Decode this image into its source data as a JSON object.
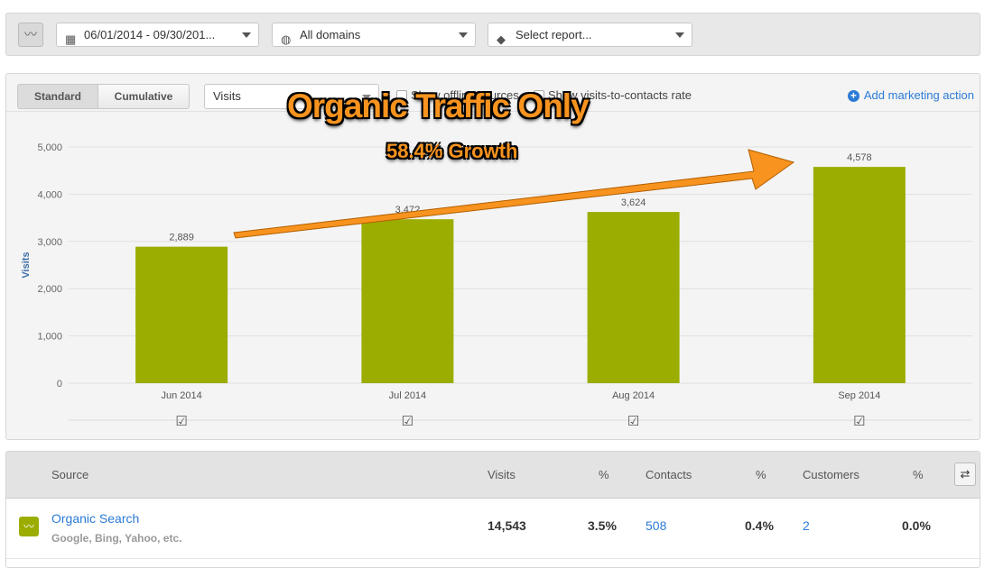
{
  "toolbar": {
    "date_range": "06/01/2014 - 09/30/201...",
    "domains": "All domains",
    "report": "Select report..."
  },
  "controls": {
    "standard": "Standard",
    "cumulative": "Cumulative",
    "metric": "Visits",
    "show_offline": "Show offline sources",
    "show_rate": "Show visits-to-contacts rate",
    "add_action": "Add marketing action"
  },
  "annotation": {
    "title": "Organic Traffic Only",
    "subtitle": "58.4% Growth"
  },
  "chart_data": {
    "type": "bar",
    "categories": [
      "Jun 2014",
      "Jul 2014",
      "Aug 2014",
      "Sep 2014"
    ],
    "values": [
      2889,
      3470,
      3624,
      4578
    ],
    "labels": [
      "2,889",
      "3,47?",
      "3,624",
      "4,578"
    ],
    "ylabel": "Visits",
    "ylim": [
      0,
      5000
    ],
    "yticks": [
      "0",
      "1,000",
      "2,000",
      "3,000",
      "4,000",
      "5,000"
    ],
    "grid": true,
    "color": "#9aad00"
  },
  "table": {
    "headers": [
      "Source",
      "Visits",
      "%",
      "Contacts",
      "%",
      "Customers",
      "%"
    ],
    "rows": [
      {
        "source": "Organic Search",
        "sub": "Google, Bing, Yahoo, etc.",
        "visits": "14,543",
        "visits_pct": "3.5%",
        "contacts": "508",
        "contacts_pct": "0.4%",
        "customers": "2",
        "customers_pct": "0.0%"
      }
    ]
  }
}
